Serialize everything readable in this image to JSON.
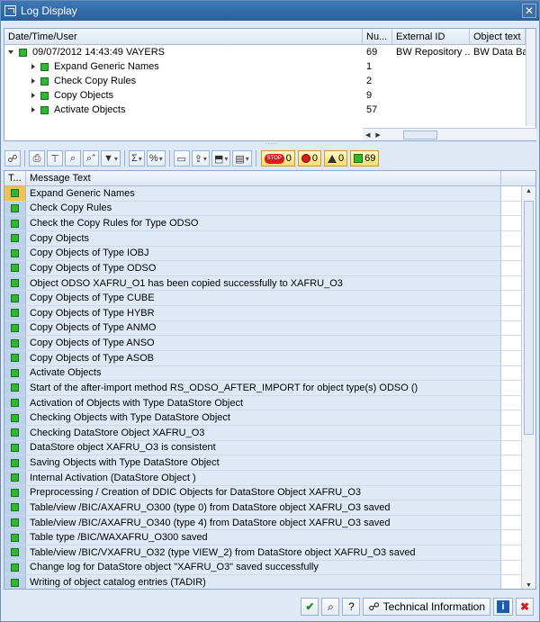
{
  "window": {
    "title": "Log Display",
    "close_glyph": "✕"
  },
  "tree": {
    "columns": [
      "Date/Time/User",
      "Nu...",
      "External ID",
      "Object text"
    ],
    "root": {
      "label": "09/07/2012  14:43:49  VAYERS",
      "number": "69",
      "external_id": "BW Repository ...",
      "object_text": "BW Data Bas"
    },
    "children": [
      {
        "label": "Expand Generic Names",
        "number": "1"
      },
      {
        "label": "Check Copy Rules",
        "number": "2"
      },
      {
        "label": "Copy Objects",
        "number": "9"
      },
      {
        "label": "Activate Objects",
        "number": "57"
      }
    ],
    "splitter_glyph": "·····"
  },
  "toolbar": {
    "icons": [
      "detail-icon",
      "print-icon",
      "filter-icon",
      "find-icon",
      "find-next-icon",
      "set-filter-icon",
      "sum-icon",
      "subtotal-icon",
      "print-preview-icon",
      "export-icon",
      "save-icon",
      "layout-icon",
      "column-icon"
    ],
    "glyphs": {
      "detail": "☍",
      "print": "⎙",
      "filter": "⊤",
      "find": "⌕",
      "find_next": "⌕⁺",
      "set_filter": "▼",
      "sum": "Σ",
      "subtotal": "%",
      "print_preview": "▭",
      "export": "⇪",
      "save": "⬒",
      "layout": "▤"
    },
    "counts": {
      "stop_label": "STOP",
      "stop": "0",
      "error": "0",
      "warning": "0",
      "success": "69"
    }
  },
  "messages": {
    "columns": [
      "T...",
      "Message Text"
    ],
    "rows": [
      "Expand Generic Names",
      "Check Copy Rules",
      "Check the Copy Rules for Type ODSO",
      "Copy Objects",
      "Copy Objects of Type IOBJ",
      "Copy Objects of Type ODSO",
      "Object ODSO XAFRU_O1 has been copied successfully to XAFRU_O3",
      "Copy Objects of Type CUBE",
      "Copy Objects of Type HYBR",
      "Copy Objects of Type ANMO",
      "Copy Objects of Type ANSO",
      "Copy Objects of Type ASOB",
      "Activate Objects",
      "Start of the after-import method RS_ODSO_AFTER_IMPORT for object type(s) ODSO ()",
      "Activation of Objects with Type DataStore Object",
      "Checking Objects with Type DataStore Object",
      "Checking DataStore Object XAFRU_O3",
      "DataStore object XAFRU_O3 is consistent",
      "Saving Objects with Type DataStore Object",
      "Internal Activation (DataStore Object )",
      "Preprocessing / Creation of DDIC Objects for DataStore Object XAFRU_O3",
      "Table/view /BIC/AXAFRU_O300 (type 0) from DataStore object XAFRU_O3 saved",
      "Table/view /BIC/AXAFRU_O340 (type 4) from DataStore object XAFRU_O3 saved",
      "Table type /BIC/WAXAFRU_O300 saved",
      "Table/view /BIC/VXAFRU_O32 (type VIEW_2) from DataStore object XAFRU_O3 saved",
      "Change log for DataStore object \"XAFRU_O3\" saved successfully",
      "Writing of object catalog entries (TADIR)"
    ],
    "selected_index": 0
  },
  "footer": {
    "technical_information_label": "Technical Information",
    "glyphs": {
      "continue": "✔",
      "find": "⌕",
      "help": "?",
      "tech": "☍",
      "info": "i",
      "cancel": "✖"
    }
  },
  "colors": {
    "status_success": "#2fb72f",
    "selected_row": "#f3c24b",
    "title_bar": "#2a5f9a"
  }
}
